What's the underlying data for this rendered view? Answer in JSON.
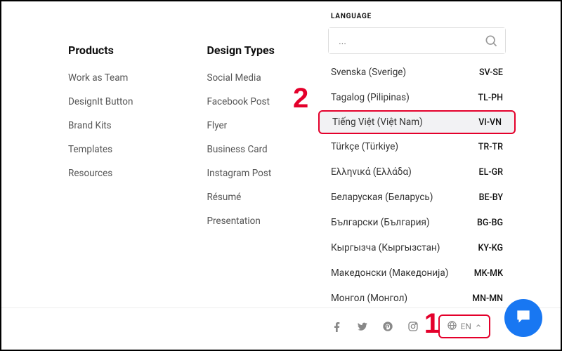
{
  "columns": {
    "products": {
      "heading": "Products",
      "items": [
        "Work as Team",
        "DesignIt Button",
        "Brand Kits",
        "Templates",
        "Resources"
      ]
    },
    "designTypes": {
      "heading": "Design Types",
      "items": [
        "Social Media",
        "Facebook Post",
        "Flyer",
        "Business Card",
        "Instagram Post",
        "Résumé",
        "Presentation"
      ]
    }
  },
  "languagePanel": {
    "header": "LANGUAGE",
    "searchPlaceholder": "...",
    "options": [
      {
        "label": "Svenska (Sverige)",
        "code": "SV-SE"
      },
      {
        "label": "Tagalog (Pilipinas)",
        "code": "TL-PH"
      },
      {
        "label": "Tiếng Việt (Việt Nam)",
        "code": "VI-VN",
        "highlight": true
      },
      {
        "label": "Türkçe (Türkiye)",
        "code": "TR-TR"
      },
      {
        "label": "Ελληνικά (Ελλάδα)",
        "code": "EL-GR"
      },
      {
        "label": "Беларуская (Беларусь)",
        "code": "BE-BY"
      },
      {
        "label": "Български (България)",
        "code": "BG-BG"
      },
      {
        "label": "Кыргызча (Кыргызстан)",
        "code": "KY-KG"
      },
      {
        "label": "Македонски (Македонија)",
        "code": "MK-MK"
      },
      {
        "label": "Монгол (Монгол)",
        "code": "MN-MN"
      }
    ]
  },
  "bottomBar": {
    "currentLang": "EN"
  },
  "annotations": {
    "one": "1",
    "two": "2"
  }
}
